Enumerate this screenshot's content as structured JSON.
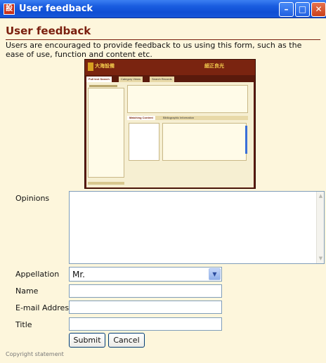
{
  "window": {
    "title": "User feedback",
    "app_icon_glyph": "設",
    "minimize_glyph": "–",
    "maximize_glyph": "□",
    "close_glyph": "✕"
  },
  "page": {
    "heading": "User feedback",
    "intro": "Users are encouraged to provide feedback to us using this form, such as the ease of use, function and content etc."
  },
  "preview": {
    "brand_left": "大海設備",
    "brand_right": "細正良光",
    "tabs": [
      "Full text Search",
      "Category Views",
      "Search Records"
    ],
    "subtabs": [
      "Matching Content",
      "Bibliographic Information"
    ]
  },
  "form": {
    "opinions_label": "Opinions",
    "opinions_value": "",
    "appellation_label": "Appellation",
    "appellation_value": "Mr.",
    "name_label": "Name",
    "name_value": "",
    "email_label": "E-mail Address",
    "email_value": "",
    "title_label": "Title",
    "title_value": "",
    "submit_label": "Submit",
    "cancel_label": "Cancel"
  },
  "footer": {
    "copyright": "Copyright statement"
  },
  "colors": {
    "accent": "#7a1f0e",
    "background": "#fdf6dc",
    "titlebar": "#1a5de0"
  }
}
